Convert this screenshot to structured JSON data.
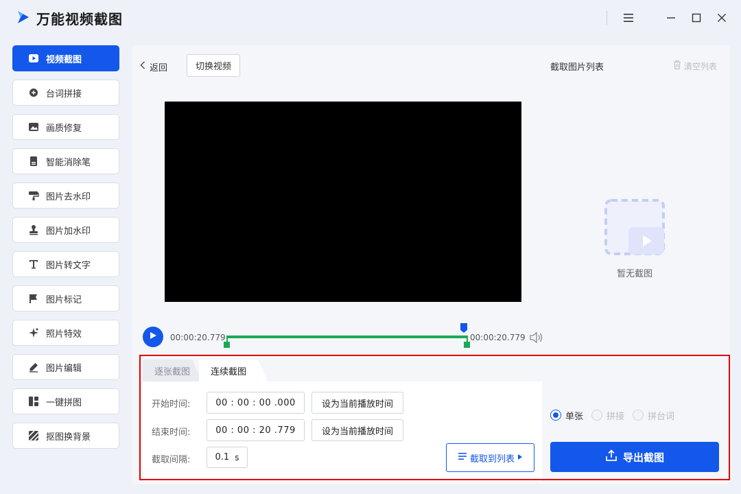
{
  "app": {
    "title": "万能视频截图"
  },
  "window_controls": [
    "menu-icon",
    "minimize-icon",
    "maximize-icon",
    "close-icon"
  ],
  "sidebar": {
    "items": [
      {
        "label": "视频截图",
        "icon": "video-capture-icon",
        "active": true
      },
      {
        "label": "台词拼接",
        "icon": "plus-circle-icon",
        "active": false
      },
      {
        "label": "画质修复",
        "icon": "image-icon",
        "active": false
      },
      {
        "label": "智能消除笔",
        "icon": "document-icon",
        "active": false
      },
      {
        "label": "图片去水印",
        "icon": "paint-roller-icon",
        "active": false
      },
      {
        "label": "图片加水印",
        "icon": "stamp-icon",
        "active": false
      },
      {
        "label": "图片转文字",
        "icon": "text-icon",
        "active": false
      },
      {
        "label": "图片标记",
        "icon": "flag-icon",
        "active": false
      },
      {
        "label": "照片特效",
        "icon": "sparkle-icon",
        "active": false
      },
      {
        "label": "图片编辑",
        "icon": "pencil-icon",
        "active": false
      },
      {
        "label": "一键拼图",
        "icon": "collage-icon",
        "active": false
      },
      {
        "label": "抠图换背景",
        "icon": "stripes-icon",
        "active": false
      }
    ]
  },
  "toolbar": {
    "back_label": "返回",
    "switch_video_label": "切换视频",
    "list_title": "截取图片列表",
    "clear_list_label": "清空列表"
  },
  "empty_state": {
    "text": "暂无截图"
  },
  "player": {
    "current_time": "00:00:20.779",
    "end_time": "00:00:20.779",
    "playhead_fraction": 1.0
  },
  "capture": {
    "tabs": [
      {
        "label": "逐张截图",
        "active": false
      },
      {
        "label": "连续截图",
        "active": true
      }
    ],
    "start_label": "开始时间:",
    "start_value": "00 : 00 : 00 .000",
    "end_label": "结束时间:",
    "end_value": "00 : 00 : 20 .779",
    "set_current_label": "设为当前播放时间",
    "interval_label": "截取间隔:",
    "interval_value": "0.1",
    "interval_unit": "s",
    "capture_to_list_label": "截取到列表"
  },
  "export": {
    "modes": [
      {
        "label": "单张",
        "selected": true
      },
      {
        "label": "拼接",
        "selected": false
      },
      {
        "label": "拼台词",
        "selected": false
      }
    ],
    "export_label": "导出截图"
  },
  "colors": {
    "accent": "#1358ea",
    "track": "#1aaa55",
    "highlight_box": "#e00000"
  }
}
